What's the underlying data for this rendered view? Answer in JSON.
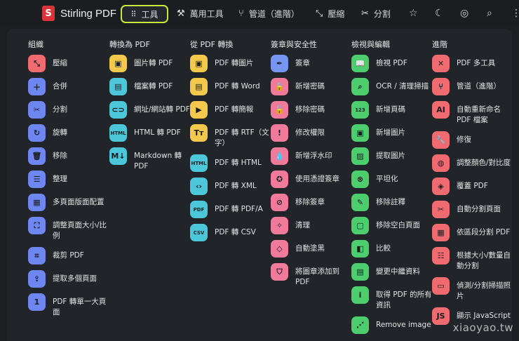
{
  "app": {
    "name": "Stirling PDF",
    "logo_letter": "S"
  },
  "nav": {
    "tools": "工具",
    "multi_tool": "萬用工具",
    "pipeline": "管道（進階）",
    "compress": "壓縮",
    "split": "分割"
  },
  "columns": [
    {
      "title": "組織",
      "items": [
        {
          "label": "壓縮",
          "color": "red",
          "icon": "compress-icon",
          "glyph": "⤡"
        },
        {
          "label": "合併",
          "color": "purple",
          "icon": "merge-icon",
          "glyph": "＋"
        },
        {
          "label": "分割",
          "color": "purple",
          "icon": "scissors-icon",
          "glyph": "✂"
        },
        {
          "label": "旋轉",
          "color": "purple",
          "icon": "rotate-icon",
          "glyph": "↻"
        },
        {
          "label": "移除",
          "color": "purple",
          "icon": "trash-icon",
          "glyph": "🗑"
        },
        {
          "label": "整理",
          "color": "purple",
          "icon": "list-icon",
          "glyph": "☰"
        },
        {
          "label": "多頁面版面配置",
          "color": "purple",
          "icon": "grid-icon",
          "glyph": "▦"
        },
        {
          "label": "調整頁面大小/比例",
          "color": "purple",
          "icon": "resize-icon",
          "glyph": "⛶"
        },
        {
          "label": "裁剪 PDF",
          "color": "purple",
          "icon": "crop-icon",
          "glyph": "⌗"
        },
        {
          "label": "提取多個頁面",
          "color": "purple",
          "icon": "upload-icon",
          "glyph": "⇪"
        },
        {
          "label": "PDF 轉單一大頁面",
          "color": "purple",
          "icon": "page-icon",
          "glyph": "1"
        }
      ]
    },
    {
      "title": "轉換為 PDF",
      "items": [
        {
          "label": "圖片轉 PDF",
          "color": "yellow",
          "icon": "image-icon",
          "glyph": "▣"
        },
        {
          "label": "檔案轉 PDF",
          "color": "cyan",
          "icon": "file-icon",
          "glyph": "▤"
        },
        {
          "label": "網址/網站轉 PDF",
          "color": "cyan",
          "icon": "link-icon",
          "glyph": "⊂⊃"
        },
        {
          "label": "HTML 轉 PDF",
          "color": "cyan",
          "icon": "html-icon",
          "glyph": "HTML"
        },
        {
          "label": "Markdown 轉 PDF",
          "color": "cyan",
          "icon": "markdown-icon",
          "glyph": "M↓"
        }
      ]
    },
    {
      "title": "從 PDF 轉換",
      "items": [
        {
          "label": "PDF 轉圖片",
          "color": "yellow",
          "icon": "image-icon",
          "glyph": "▣"
        },
        {
          "label": "PDF 轉 Word",
          "color": "yellow",
          "icon": "word-icon",
          "glyph": "▤"
        },
        {
          "label": "PDF 轉簡報",
          "color": "yellow",
          "icon": "slides-icon",
          "glyph": "▶"
        },
        {
          "label": "PDF 轉 RTF（文字）",
          "color": "yellow",
          "icon": "text-icon",
          "glyph": "Tт"
        },
        {
          "label": "PDF 轉 HTML",
          "color": "cyan",
          "icon": "html-icon",
          "glyph": "HTML"
        },
        {
          "label": "PDF 轉 XML",
          "color": "cyan",
          "icon": "code-icon",
          "glyph": "‹›"
        },
        {
          "label": "PDF 轉 PDF/A",
          "color": "cyan",
          "icon": "pdfa-icon",
          "glyph": "PDF"
        },
        {
          "label": "PDF 轉 CSV",
          "color": "cyan",
          "icon": "csv-icon",
          "glyph": "CSV"
        }
      ]
    },
    {
      "title": "簽章與安全性",
      "items": [
        {
          "label": "簽章",
          "color": "blue",
          "icon": "signature-icon",
          "glyph": "✒"
        },
        {
          "label": "新增密碼",
          "color": "pink",
          "icon": "lock-icon",
          "glyph": "🔒"
        },
        {
          "label": "移除密碼",
          "color": "pink",
          "icon": "unlock-icon",
          "glyph": "🔓"
        },
        {
          "label": "修改權限",
          "color": "pink",
          "icon": "shield-icon",
          "glyph": "!"
        },
        {
          "label": "新增浮水印",
          "color": "pink",
          "icon": "drop-icon",
          "glyph": "💧"
        },
        {
          "label": "使用憑證簽章",
          "color": "pink",
          "icon": "certificate-icon",
          "glyph": "✪"
        },
        {
          "label": "移除簽章",
          "color": "pink",
          "icon": "remove-signature-icon",
          "glyph": "⊘"
        },
        {
          "label": "清理",
          "color": "pink",
          "icon": "clean-icon",
          "glyph": "✧"
        },
        {
          "label": "自動塗黑",
          "color": "pink",
          "icon": "eraser-icon",
          "glyph": "◇"
        },
        {
          "label": "將圖章添加到 PDF",
          "color": "pink",
          "icon": "stamp-icon",
          "glyph": "⛉"
        }
      ]
    },
    {
      "title": "檢視與編輯",
      "items": [
        {
          "label": "檢視 PDF",
          "color": "green",
          "icon": "book-icon",
          "glyph": "📖"
        },
        {
          "label": "OCR / 清理掃描",
          "color": "green",
          "icon": "ocr-icon",
          "glyph": "⌕"
        },
        {
          "label": "新增頁碼",
          "color": "green",
          "icon": "page-number-icon",
          "glyph": "123"
        },
        {
          "label": "新增圖片",
          "color": "green",
          "icon": "add-image-icon",
          "glyph": "▣"
        },
        {
          "label": "提取圖片",
          "color": "green",
          "icon": "extract-image-icon",
          "glyph": "▨"
        },
        {
          "label": "平坦化",
          "color": "green",
          "icon": "flatten-icon",
          "glyph": "⊗"
        },
        {
          "label": "移除註釋",
          "color": "green",
          "icon": "annotation-icon",
          "glyph": "✎"
        },
        {
          "label": "移除空白頁面",
          "color": "green",
          "icon": "blank-page-icon",
          "glyph": "▢"
        },
        {
          "label": "比較",
          "color": "green",
          "icon": "compare-icon",
          "glyph": "◧"
        },
        {
          "label": "變更中繼資料",
          "color": "green",
          "icon": "metadata-icon",
          "glyph": "▤"
        },
        {
          "label": "取得 PDF 的所有資訊",
          "color": "green",
          "icon": "info-icon",
          "glyph": "i"
        },
        {
          "label": "Remove image",
          "color": "green",
          "icon": "remove-image-icon",
          "glyph": "⋰"
        }
      ]
    },
    {
      "title": "進階",
      "items": [
        {
          "label": "PDF 多工具",
          "color": "red",
          "icon": "tools-icon",
          "glyph": "✕"
        },
        {
          "label": "管道（進階）",
          "color": "red",
          "icon": "pipeline-icon",
          "glyph": "⑂"
        },
        {
          "label": "自動重新命名 PDF 檔案",
          "color": "red",
          "icon": "rename-icon",
          "glyph": "AI"
        },
        {
          "label": "修復",
          "color": "red",
          "icon": "wrench-icon",
          "glyph": "🔧"
        },
        {
          "label": "調整顏色/對比度",
          "color": "red",
          "icon": "palette-icon",
          "glyph": "◍"
        },
        {
          "label": "覆蓋 PDF",
          "color": "red",
          "icon": "layers-icon",
          "glyph": "◈"
        },
        {
          "label": "自動分割頁面",
          "color": "red",
          "icon": "scissors-icon",
          "glyph": "✂"
        },
        {
          "label": "依區段分割 PDF",
          "color": "red",
          "icon": "table-icon",
          "glyph": "▦"
        },
        {
          "label": "根據大小/數量自動分割",
          "color": "red",
          "icon": "split-size-icon",
          "glyph": "☷"
        },
        {
          "label": "偵測/分割掃描照片",
          "color": "red",
          "icon": "scan-photo-icon",
          "glyph": "▭"
        },
        {
          "label": "顯示 JavaScript",
          "color": "red",
          "icon": "javascript-icon",
          "glyph": "JS"
        }
      ]
    }
  ],
  "watermark": "xiaoyao.tw",
  "icons": {
    "star": "star-icon",
    "theme": "moon-icon",
    "language": "globe-icon",
    "search": "search-icon",
    "menu": "menu-dots-icon"
  }
}
